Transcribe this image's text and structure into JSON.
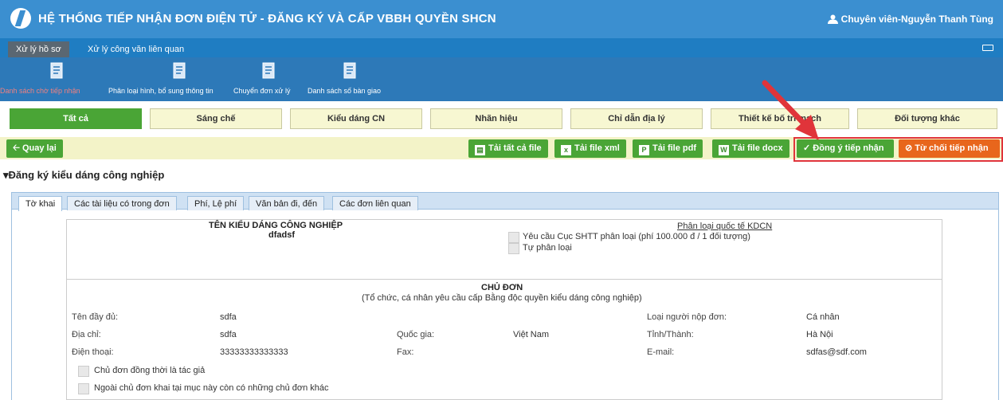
{
  "header": {
    "app_title": "HỆ THỐNG TIẾP NHẬN ĐƠN ĐIỆN TỬ - ĐĂNG KÝ VÀ CẤP VBBH QUYỀN SHCN",
    "user_label": "Chuyên viên-Nguyễn Thanh Tùng"
  },
  "tabs": [
    {
      "label": "Xử lý hồ sơ",
      "active": true
    },
    {
      "label": "Xử lý công văn liên quan",
      "active": false
    }
  ],
  "toolbar_icons": [
    {
      "label": "Danh sách chờ tiếp nhận",
      "icon": "document-list-icon",
      "active": true
    },
    {
      "label": "Phân loại hình, bổ sung thông tin",
      "icon": "document-list-icon",
      "active": false
    },
    {
      "label": "Chuyển đơn xử lý",
      "icon": "document-list-icon",
      "active": false
    },
    {
      "label": "Danh sách số bàn giao",
      "icon": "document-list-icon",
      "active": false
    }
  ],
  "categories": [
    {
      "label": "Tất cả",
      "active": true
    },
    {
      "label": "Sáng chế",
      "active": false
    },
    {
      "label": "Kiểu dáng CN",
      "active": false
    },
    {
      "label": "Nhãn hiệu",
      "active": false
    },
    {
      "label": "Chỉ dẫn địa lý",
      "active": false
    },
    {
      "label": "Thiết kế bố trí mạch",
      "active": false
    },
    {
      "label": "Đối tượng khác",
      "active": false
    }
  ],
  "actions": {
    "back": "Quay lại",
    "download_all": "Tải tất cả file",
    "download_xml": "Tải file xml",
    "download_pdf": "Tải file pdf",
    "download_docx": "Tải file docx",
    "accept": "Đồng ý tiếp nhận",
    "reject": "Từ chối tiếp nhận"
  },
  "colors": {
    "header_blue": "#3b8fd0",
    "active_green": "#4aa536",
    "reject_orange": "#e8661c",
    "highlight_red": "#e0343a"
  },
  "section_title": "Đăng ký kiểu dáng công nghiệp",
  "form_tabs": [
    {
      "label": "Tờ khai",
      "active": true
    },
    {
      "label": "Các tài liệu có trong đơn",
      "active": false
    },
    {
      "label": "Phí, Lệ phí",
      "active": false
    },
    {
      "label": "Văn bản đi, đến",
      "active": false
    },
    {
      "label": "Các đơn liên quan",
      "active": false
    }
  ],
  "design": {
    "heading": "TÊN KIỂU DÁNG CÔNG NGHIỆP",
    "name": "dfadsf",
    "classification_link": "Phân loại quốc tế KDCN",
    "option_1": "Yêu cầu Cục SHTT phân loại (phí 100.000 đ / 1 đối tượng)",
    "option_2": "Tự phân loại"
  },
  "owner": {
    "heading": "CHỦ ĐƠN",
    "subheading": "(Tổ chức, cá nhân yêu cầu cấp Bằng độc quyền kiểu dáng công nghiệp)",
    "fullname_label": "Tên đầy đủ:",
    "fullname": "sdfa",
    "applicant_type_label": "Loại người nộp đơn:",
    "applicant_type": "Cá nhân",
    "address_label": "Địa chỉ:",
    "address": "sdfa",
    "country_label": "Quốc gia:",
    "country": "Việt Nam",
    "province_label": "Tỉnh/Thành:",
    "province": "Hà Nội",
    "phone_label": "Điện thoại:",
    "phone": "33333333333333",
    "fax_label": "Fax:",
    "fax": "",
    "email_label": "E-mail:",
    "email": "sdfas@sdf.com",
    "check_1": "Chủ đơn đồng thời là tác giả",
    "check_2": "Ngoài chủ đơn khai tại mục này còn có những chủ đơn khác"
  }
}
